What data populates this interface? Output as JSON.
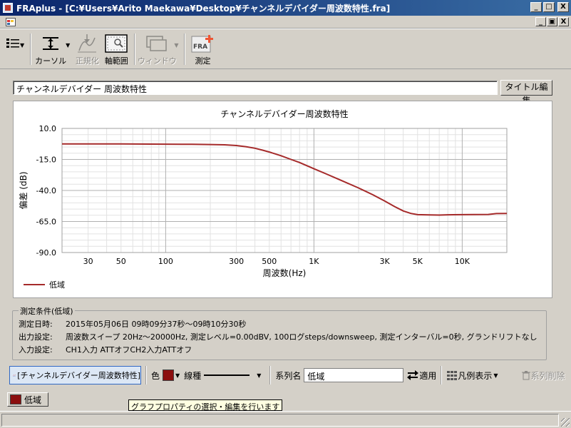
{
  "window": {
    "title": "FRAplus - [C:¥Users¥Arito Maekawa¥Desktop¥チャンネルデバイダー周波数特性.fra]",
    "minimize": "_",
    "maximize": "□",
    "close": "X",
    "mdi_minimize": "_",
    "mdi_restore": "▣",
    "mdi_close": "X"
  },
  "toolbar": {
    "cursor_label": "カーソル",
    "normalize_label": "正規化",
    "axis_range_label": "軸範囲",
    "window_label": "ウィンドウ",
    "measure_label": "測定",
    "fra_text": "FRA"
  },
  "graph": {
    "title_input": "チャンネルデバイダー  周波数特性",
    "title_edit_button": "タイトル編集"
  },
  "chart_data": {
    "type": "line",
    "title": "チャンネルデバイダー周波数特性",
    "xlabel": "周波数(Hz)",
    "ylabel": "偏差 (dB)",
    "xscale": "log",
    "xlim": [
      20,
      20000
    ],
    "ylim": [
      -90,
      10
    ],
    "yticks": [
      "10.0",
      "-15.0",
      "-40.0",
      "-65.0",
      "-90.0"
    ],
    "yticks_values": [
      10,
      -15,
      -40,
      -65,
      -90
    ],
    "xticks": [
      "30",
      "50",
      "100",
      "300",
      "500",
      "1K",
      "3K",
      "5K",
      "10K"
    ],
    "xticks_values": [
      30,
      50,
      100,
      300,
      500,
      1000,
      3000,
      5000,
      10000
    ],
    "grid": true,
    "legend_position": "bottom-left",
    "series": [
      {
        "name": "低域",
        "color": "#a52a2a",
        "x": [
          20,
          30,
          50,
          100,
          150,
          200,
          250,
          300,
          350,
          400,
          450,
          500,
          600,
          700,
          800,
          1000,
          1200,
          1500,
          2000,
          2500,
          3000,
          3500,
          4000,
          4500,
          5000,
          6000,
          7000,
          8000,
          10000,
          12000,
          15000,
          17000,
          20000
        ],
        "y": [
          -2.5,
          -2.5,
          -2.5,
          -2.7,
          -2.8,
          -3.0,
          -3.2,
          -3.8,
          -4.8,
          -6.0,
          -7.5,
          -9.0,
          -12.0,
          -15.0,
          -17.5,
          -22.5,
          -26.5,
          -31.5,
          -38.0,
          -43.5,
          -48.5,
          -53.0,
          -56.5,
          -58.5,
          -59.5,
          -59.7,
          -59.8,
          -59.6,
          -59.5,
          -59.4,
          -59.3,
          -58.6,
          -58.5
        ]
      }
    ]
  },
  "conditions": {
    "group_title": "測定条件(低域)",
    "rows": [
      {
        "key": "測定日時:",
        "value": "2015年05月06日  09時09分37秒～09時10分30秒"
      },
      {
        "key": "出力設定:",
        "value": "周波数スイープ  20Hz～20000Hz, 測定レベル=0.00dBV, 100ログsteps/downsweep, 測定インターバル=0秒, グランドリフトなし"
      },
      {
        "key": "入力設定:",
        "value": "CH1入力 ATTオフCH2入力ATTオフ"
      }
    ]
  },
  "series_toolbar": {
    "graph_select_label": "[チャンネルデバイダー周波数特性]",
    "color_label": "色",
    "color_value": "#8b0e0e",
    "linetype_label": "線種",
    "series_name_label": "系列名",
    "series_name_value": "低域",
    "apply_label": "適用",
    "legend_label": "凡例表示",
    "delete_label": "系列削除"
  },
  "tabs": [
    {
      "label": "低域"
    }
  ],
  "tooltip": "グラフプロパティの選択・編集を行います"
}
